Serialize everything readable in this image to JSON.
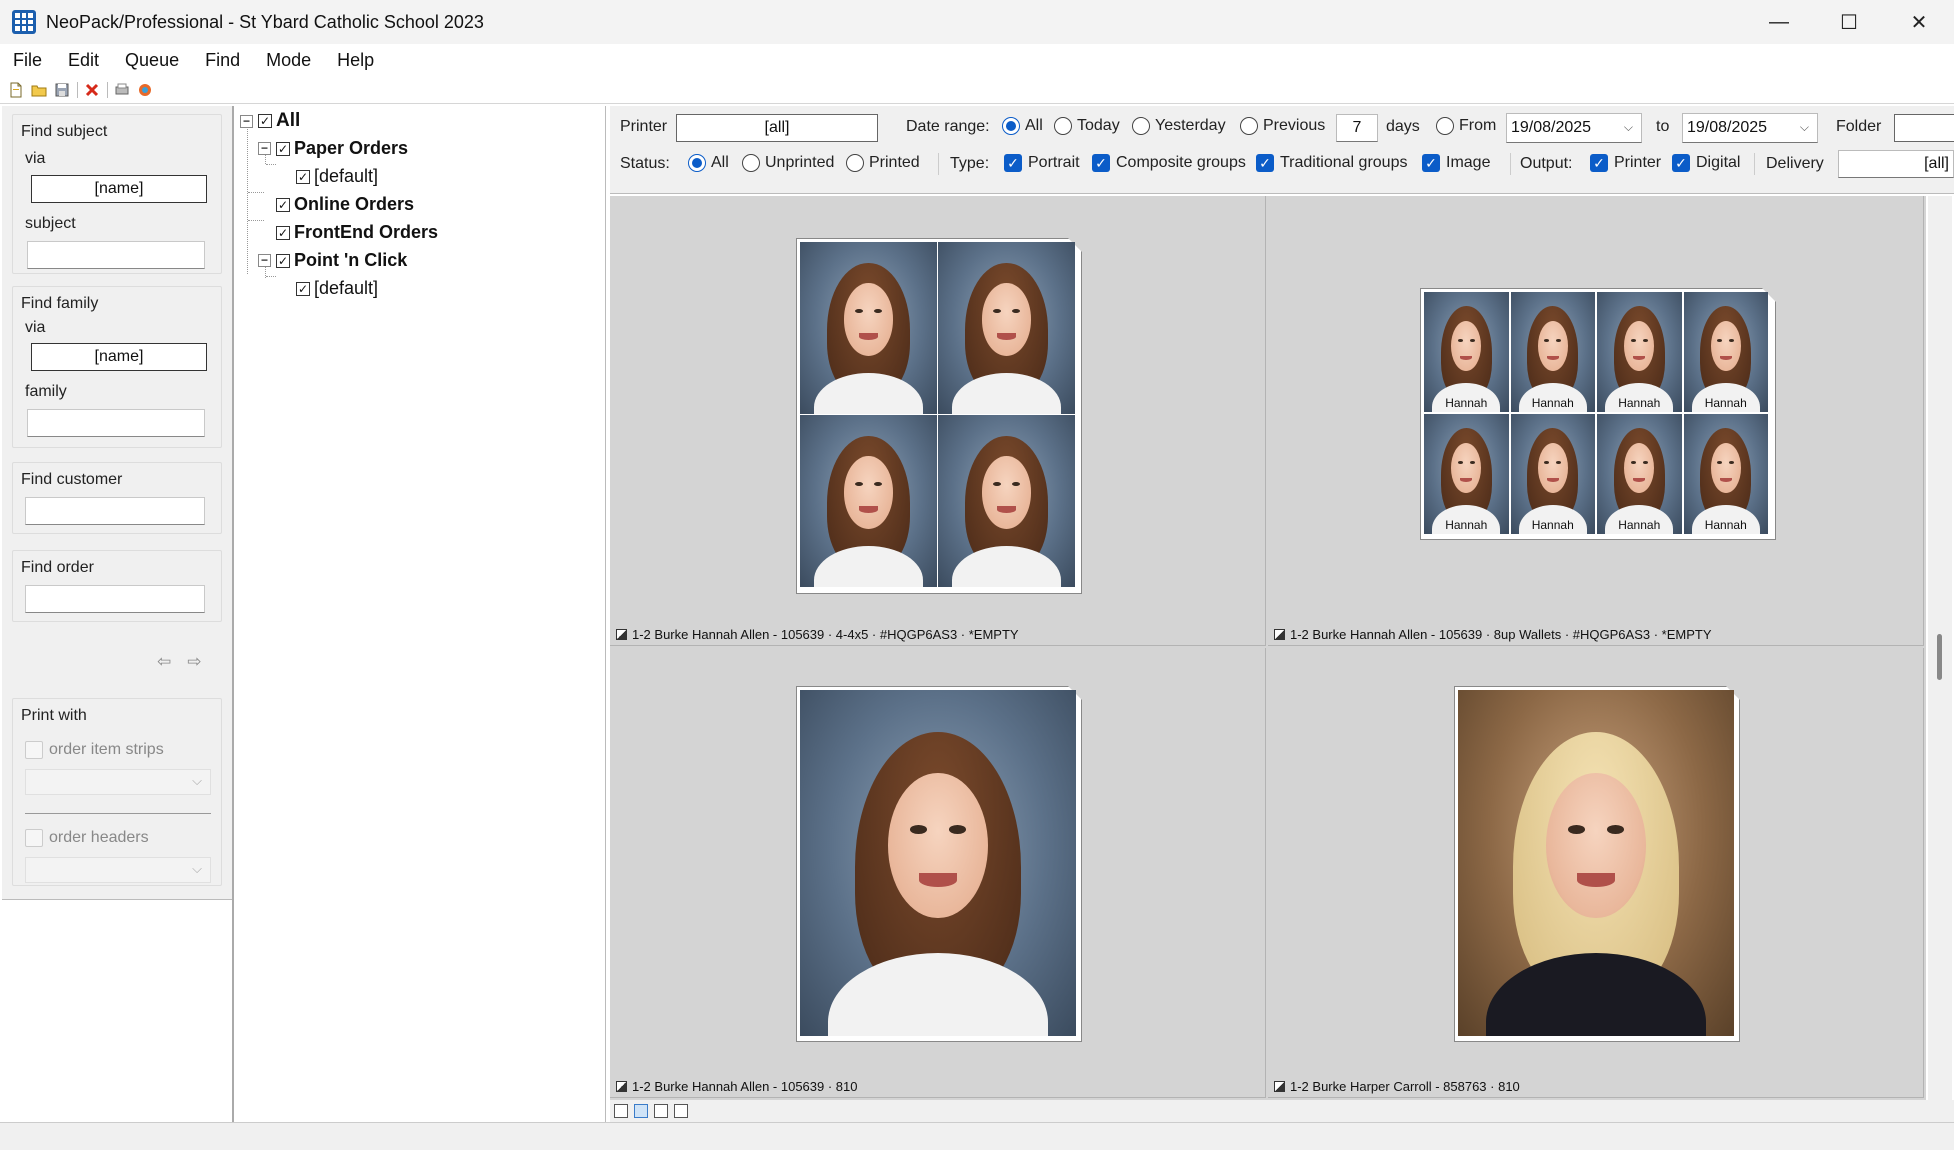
{
  "window": {
    "title": "NeoPack/Professional - St Ybard Catholic School 2023",
    "controls": {
      "minimize": "—",
      "maximize": "☐",
      "close": "✕"
    }
  },
  "menu": [
    "File",
    "Edit",
    "Queue",
    "Find",
    "Mode",
    "Help"
  ],
  "toolbar_icons": [
    "new-icon",
    "open-icon",
    "save-icon",
    "delete-icon",
    "print-preview-icon",
    "color-icon"
  ],
  "left": {
    "find_subject": {
      "title": "Find subject",
      "via_label": "via",
      "via_value": "[name]",
      "field_label": "subject",
      "field_value": ""
    },
    "find_family": {
      "title": "Find family",
      "via_label": "via",
      "via_value": "[name]",
      "field_label": "family",
      "field_value": ""
    },
    "find_customer": {
      "title": "Find customer",
      "value": ""
    },
    "find_order": {
      "title": "Find order",
      "value": ""
    },
    "nav": {
      "prev": "⇦",
      "next": "⇨"
    },
    "print_with": {
      "title": "Print with",
      "order_item_strips": "order item strips",
      "order_headers": "order headers"
    }
  },
  "tree": {
    "root": "All",
    "nodes": [
      {
        "label": "Paper Orders",
        "children": [
          "[default]"
        ]
      },
      {
        "label": "Online Orders",
        "children": []
      },
      {
        "label": "FrontEnd Orders",
        "children": []
      },
      {
        "label": "Point 'n Click",
        "children": [
          "[default]"
        ]
      }
    ]
  },
  "filters": {
    "printer_label": "Printer",
    "printer_value": "[all]",
    "date_range_label": "Date range:",
    "date_options": [
      "All",
      "Today",
      "Yesterday",
      "Previous"
    ],
    "date_selected": "All",
    "previous_days": "7",
    "days_label": "days",
    "from_label": "From",
    "from_date": "19/08/2025",
    "to_label": "to",
    "to_date": "19/08/2025",
    "folder_label": "Folder",
    "folder_value": "",
    "status_label": "Status:",
    "status_options": [
      "All",
      "Unprinted",
      "Printed"
    ],
    "status_selected": "All",
    "type_label": "Type:",
    "type_options": [
      "Portrait",
      "Composite groups",
      "Traditional groups",
      "Image"
    ],
    "output_label": "Output:",
    "output_options": [
      "Printer",
      "Digital"
    ],
    "delivery_label": "Delivery",
    "delivery_value": "[all]"
  },
  "items": [
    {
      "caption": "1-2 Burke Hannah Allen - 105639 · 4-4x5 · #HQGP6AS3 · *EMPTY",
      "layout": "4-up"
    },
    {
      "caption": "1-2 Burke Hannah Allen - 105639 · 8up Wallets · #HQGP6AS3 · *EMPTY",
      "layout": "8-up",
      "tag": "Hannah"
    },
    {
      "caption": "1-2 Burke Hannah Allen - 105639 · 810",
      "layout": "single"
    },
    {
      "caption": "1-2 Burke Harper Carroll - 858763 · 810",
      "layout": "single-blonde"
    }
  ]
}
